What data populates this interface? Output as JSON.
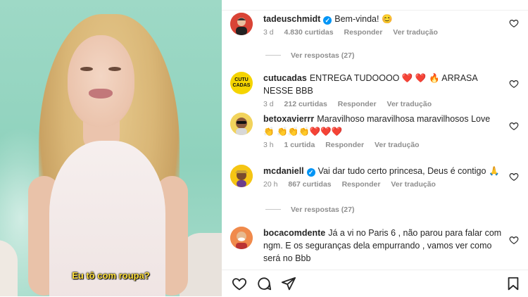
{
  "media": {
    "subtitle": "Eu tô com roupa?"
  },
  "comments": [
    {
      "username": "tadeuschmidt",
      "verified": true,
      "text": "Bem-vinda! 😊",
      "time": "3 d",
      "likes": "4.830 curtidas",
      "reply_label": "Responder",
      "translate_label": "Ver tradução",
      "view_replies": "Ver respostas (27)",
      "avatar_icon": "person-avatar"
    },
    {
      "username": "cutucadas",
      "verified": false,
      "text": "ENTREGA TUDOOOO ❤️ ❤️ 🔥 ARRASA NESSE BBB",
      "time": "3 d",
      "likes": "212 curtidas",
      "reply_label": "Responder",
      "translate_label": "Ver tradução",
      "avatar_text": "CUTU\nCADAS"
    },
    {
      "username": "betoxavierrr",
      "verified": false,
      "text": "Maravilhoso maravilhosa maravilhosos Love 👏 👏👏👏❤️❤️❤️",
      "time": "3 h",
      "likes": "1 curtida",
      "reply_label": "Responder",
      "translate_label": "Ver tradução",
      "avatar_icon": "person-avatar"
    },
    {
      "username": "mcdaniell",
      "verified": true,
      "text": "Vai dar tudo certo princesa, Deus é contigo 🙏",
      "time": "20 h",
      "likes": "867 curtidas",
      "reply_label": "Responder",
      "translate_label": "Ver tradução",
      "view_replies": "Ver respostas (27)",
      "avatar_icon": "person-avatar"
    },
    {
      "username": "bocacomdente",
      "verified": false,
      "text": "Já a vi no Paris 6 , não parou para falar com ngm. E os seguranças dela empurrando , vamos ver como será no Bbb",
      "avatar_icon": "person-avatar"
    }
  ],
  "icons": {
    "like": "heart-icon",
    "comment": "comment-icon",
    "share": "share-icon",
    "save": "bookmark-icon"
  },
  "colors": {
    "verified": "#0095f6",
    "muted": "#8e8e8e",
    "text": "#262626"
  }
}
